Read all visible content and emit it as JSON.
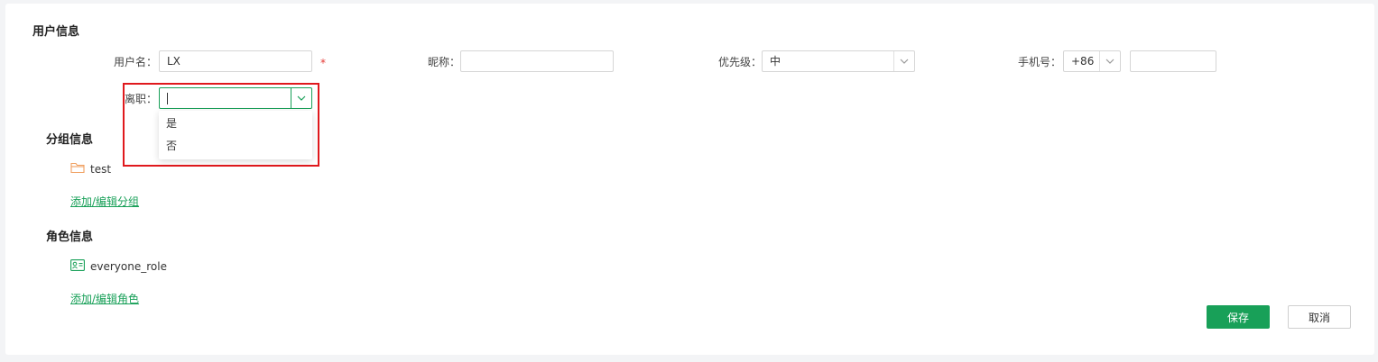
{
  "user_info": {
    "title": "用户信息",
    "username_label": "用户名：",
    "username_value": "LX",
    "required_mark": "*",
    "nickname_label": "昵称：",
    "nickname_value": "",
    "priority_label": "优先级：",
    "priority_value": "中",
    "phone_label": "手机号：",
    "phone_country_code": "+86",
    "phone_value": "",
    "resigned_label": "离职：",
    "resigned_value": "",
    "resigned_options": [
      "是",
      "否"
    ]
  },
  "group_info": {
    "title": "分组信息",
    "items": [
      "test"
    ],
    "edit_link": "添加/编辑分组"
  },
  "role_info": {
    "title": "角色信息",
    "items": [
      "everyone_role"
    ],
    "edit_link": "添加/编辑角色"
  },
  "actions": {
    "save_label": "保存",
    "cancel_label": "取消"
  },
  "colors": {
    "accent": "#18a058",
    "highlight": "#e0191d",
    "required": "#e53935",
    "folder_icon": "#f0a060"
  },
  "icons": {
    "group_item_icon": "folder-icon",
    "role_item_icon": "id-card-icon",
    "select_arrow_icon": "chevron-down-icon"
  }
}
